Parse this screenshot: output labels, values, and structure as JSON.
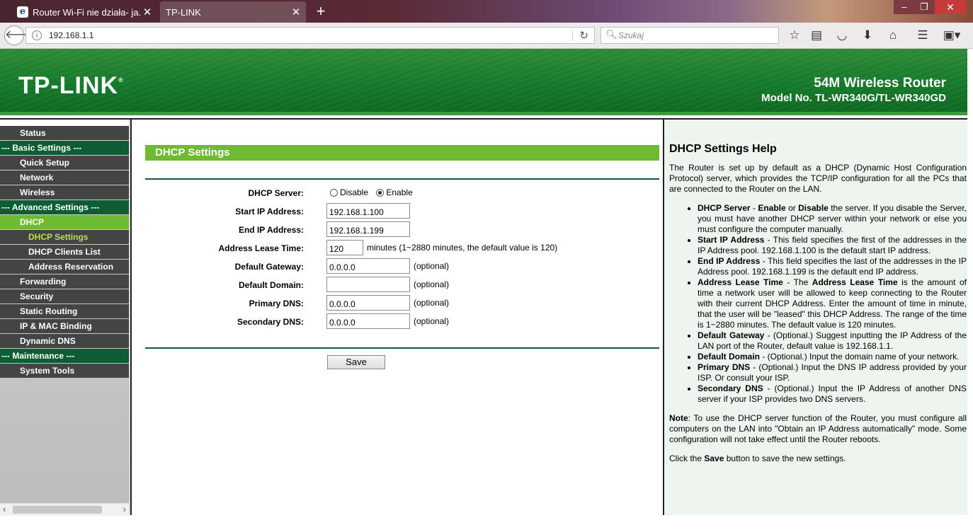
{
  "browser": {
    "tabs": [
      {
        "title": "Router Wi-Fi nie działa- ja...",
        "favicon": "e"
      },
      {
        "title": "TP-LINK"
      }
    ],
    "new_tab_label": "+",
    "url": "192.168.1.1",
    "search_placeholder": "Szukaj",
    "window_controls": {
      "minimize": "‒",
      "maximize": "❐",
      "close": "✕"
    },
    "toolbar_icons": [
      "bookmark-star-icon",
      "reading-list-icon",
      "pocket-icon",
      "download-icon",
      "home-icon",
      "menu-icon",
      "extension-icon"
    ]
  },
  "router": {
    "logo": "TP-LINK",
    "logo_mark": "®",
    "product": "54M Wireless Router",
    "model": "Model No. TL-WR340G/TL-WR340GD"
  },
  "menu": {
    "items": [
      {
        "label": "Status",
        "kind": "normal"
      },
      {
        "label": "--- Basic Settings ---",
        "kind": "group"
      },
      {
        "label": "Quick Setup",
        "kind": "normal"
      },
      {
        "label": "Network",
        "kind": "normal"
      },
      {
        "label": "Wireless",
        "kind": "normal"
      },
      {
        "label": "--- Advanced Settings ---",
        "kind": "group"
      },
      {
        "label": "DHCP",
        "kind": "active"
      },
      {
        "label": "DHCP Settings",
        "kind": "sub-active"
      },
      {
        "label": "DHCP Clients List",
        "kind": "sub"
      },
      {
        "label": "Address Reservation",
        "kind": "sub"
      },
      {
        "label": "Forwarding",
        "kind": "normal"
      },
      {
        "label": "Security",
        "kind": "normal"
      },
      {
        "label": "Static Routing",
        "kind": "normal"
      },
      {
        "label": "IP & MAC Binding",
        "kind": "normal"
      },
      {
        "label": "Dynamic DNS",
        "kind": "normal"
      },
      {
        "label": "--- Maintenance ---",
        "kind": "group"
      },
      {
        "label": "System Tools",
        "kind": "normal"
      }
    ]
  },
  "form": {
    "title": "DHCP Settings",
    "dhcp_server": {
      "label": "DHCP Server:",
      "options": [
        "Disable",
        "Enable"
      ],
      "selected": "Enable"
    },
    "start_ip": {
      "label": "Start IP Address:",
      "value": "192.168.1.100"
    },
    "end_ip": {
      "label": "End IP Address:",
      "value": "192.168.1.199"
    },
    "lease_time": {
      "label": "Address Lease Time:",
      "value": "120",
      "note": "minutes (1~2880 minutes, the default value is 120)"
    },
    "gateway": {
      "label": "Default Gateway:",
      "value": "0.0.0.0",
      "note": "(optional)"
    },
    "domain": {
      "label": "Default Domain:",
      "value": "",
      "note": "(optional)"
    },
    "primary_dns": {
      "label": "Primary DNS:",
      "value": "0.0.0.0",
      "note": "(optional)"
    },
    "secondary_dns": {
      "label": "Secondary DNS:",
      "value": "0.0.0.0",
      "note": "(optional)"
    },
    "save_label": "Save"
  },
  "help": {
    "title": "DHCP Settings Help",
    "intro": "The Router is set up by default as a DHCP (Dynamic Host Configuration Protocol) server, which provides the TCP/IP configuration for all the PCs that are connected to the Router on the LAN.",
    "items": [
      {
        "html": "<b>DHCP Server</b> - <b>Enable</b> or <b>Disable</b> the server. If you disable the Server, you must have another DHCP server within your network or else you must configure the computer manually."
      },
      {
        "html": "<b>Start IP Address</b> - This field specifies the first of the addresses in the IP Address pool. 192.168.1.100 is the default start IP address."
      },
      {
        "html": "<b>End IP Address</b> - This field specifies the last of the addresses in the IP Address pool. 192.168.1.199 is the default end IP address."
      },
      {
        "html": "<b>Address Lease Time</b> - The <b>Address Lease Time</b> is the amount of time a network user will be allowed to keep connecting to the Router with their current DHCP Address. Enter the amount of time in minute, that the user will be \"leased\" this DHCP Address. The range of the time is 1~2880 minutes. The default value is 120 minutes."
      },
      {
        "html": "<b>Default Gateway</b> - (Optional.) Suggest inputting the IP Address of the LAN port of the Router, default value is 192.168.1.1."
      },
      {
        "html": "<b>Default Domain</b> - (Optional.) Input the domain name of your network."
      },
      {
        "html": "<b>Primary DNS</b> - (Optional.) Input the DNS IP address provided by your ISP. Or consult your ISP."
      },
      {
        "html": "<b>Secondary DNS</b> - (Optional.) Input the IP Address of another DNS server if your ISP provides two DNS servers."
      }
    ],
    "note_html": "<b>Note</b>: To use the DHCP server function of the Router, you must configure all computers on the LAN into \"Obtain an IP Address automatically\" mode. Some configuration will not take effect until the Router reboots.",
    "save_html": "Click the <b>Save</b> button to save the new settings."
  }
}
